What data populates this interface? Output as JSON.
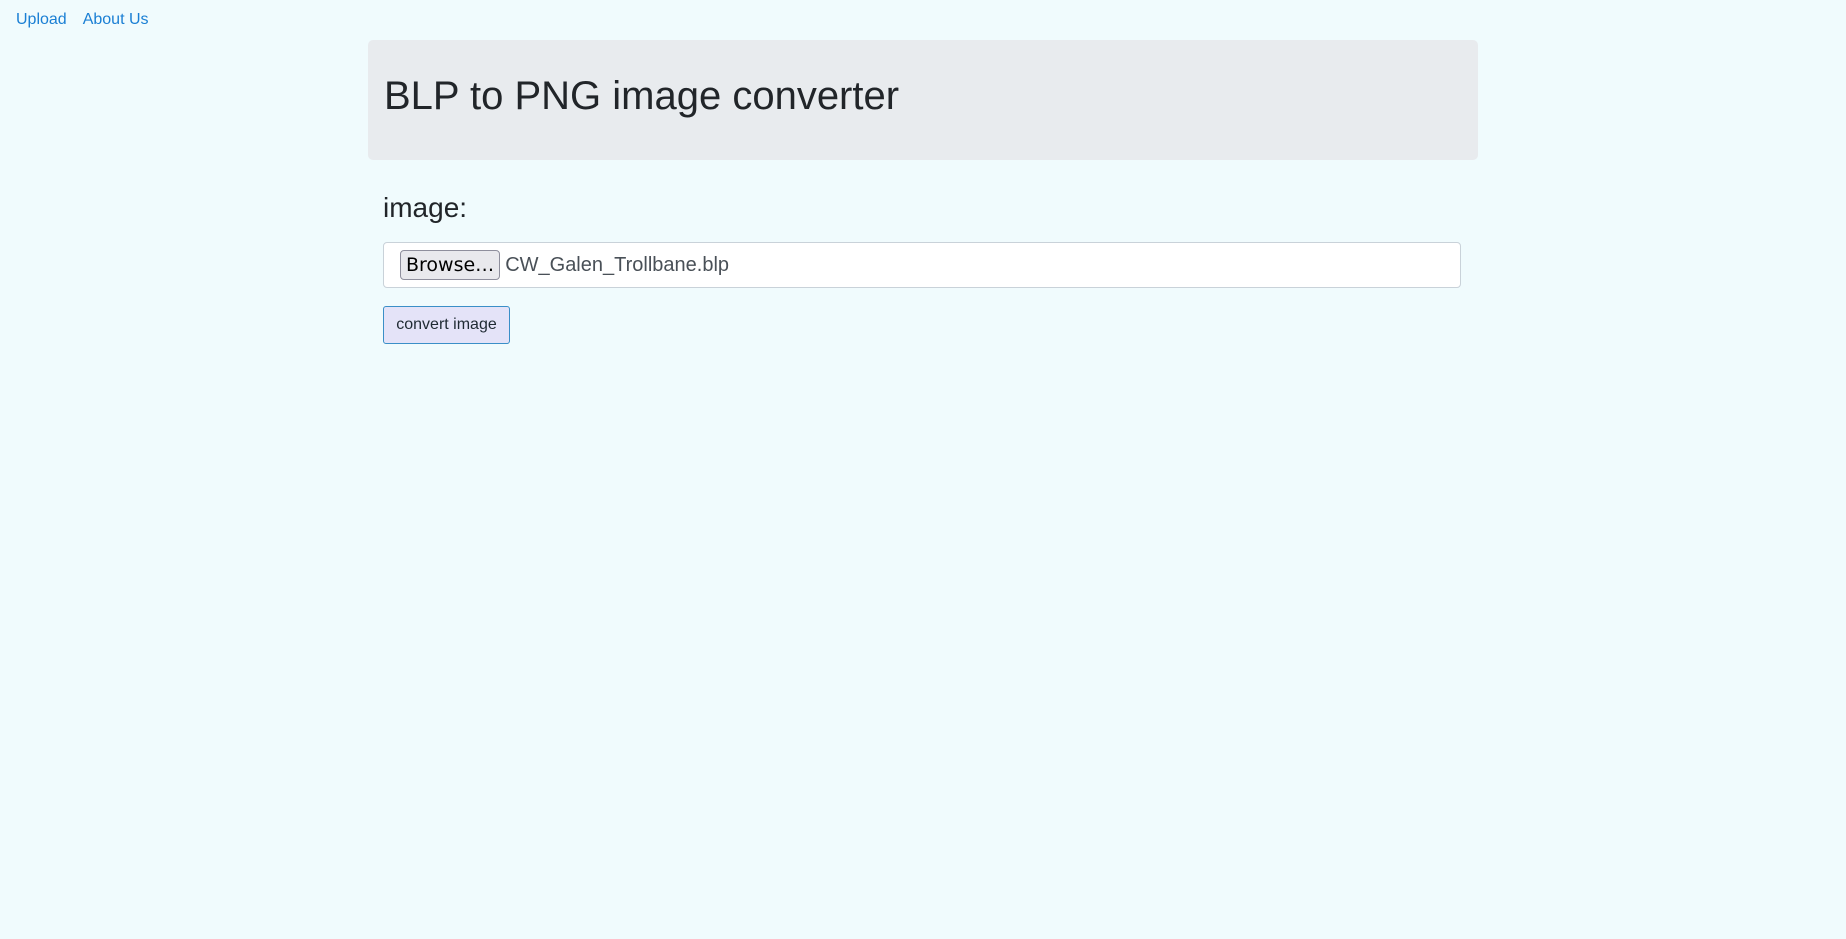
{
  "nav": {
    "items": [
      {
        "label": "Upload"
      },
      {
        "label": "About Us"
      }
    ],
    "link_color": "#1a7fd4"
  },
  "header": {
    "title": "BLP to PNG image converter"
  },
  "form": {
    "image_label": "image:",
    "file_input": {
      "browse_label": "Browse…",
      "selected_file": "CW_Galen_Trollbane.blp"
    },
    "submit_label": "convert image"
  },
  "colors": {
    "page_background": "#f0fbfd",
    "header_background": "#e8ebee",
    "button_background": "#e4e3f8",
    "button_border": "#3a8fc8"
  }
}
